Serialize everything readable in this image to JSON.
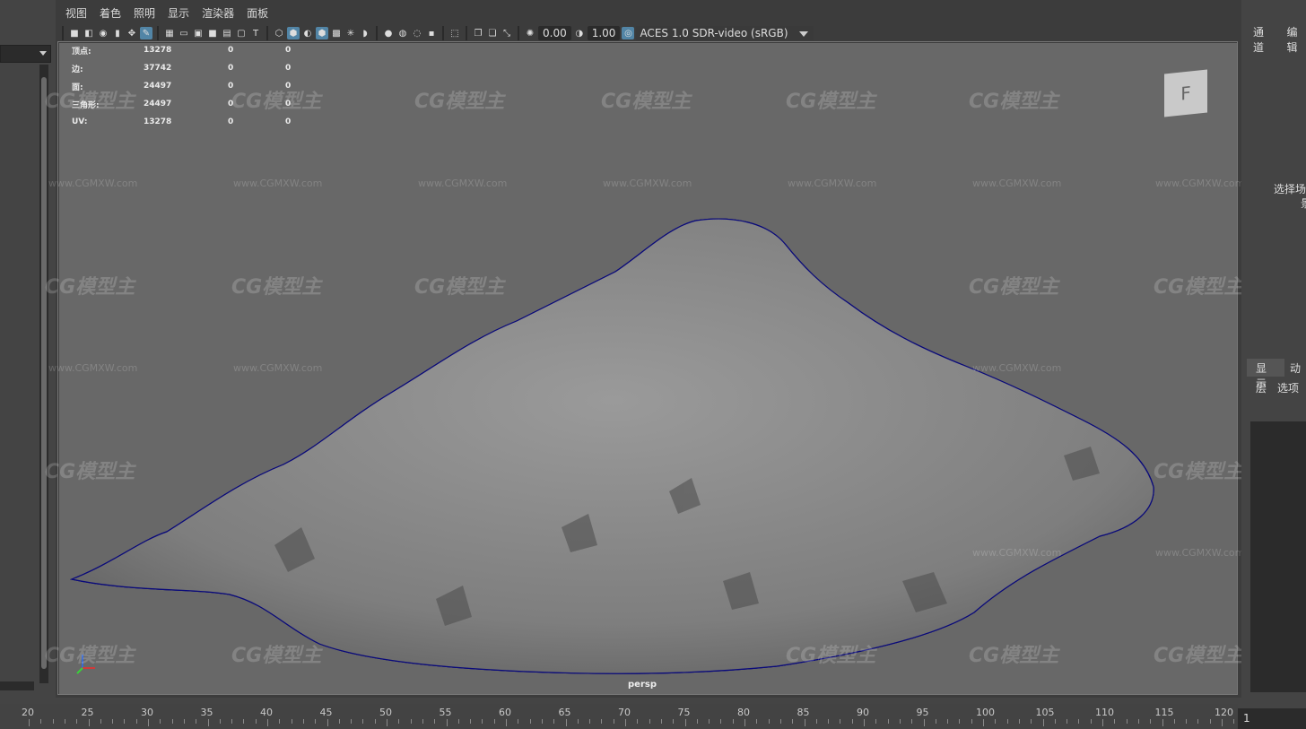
{
  "menu": [
    "视图",
    "着色",
    "照明",
    "显示",
    "渲染器",
    "面板"
  ],
  "toolbar": {
    "exposure": "0.00",
    "gamma": "1.00",
    "color_management": "ACES 1.0 SDR-video (sRGB)"
  },
  "hud": [
    {
      "label": "顶点:",
      "v1": "13278",
      "v2": "0",
      "v3": "0"
    },
    {
      "label": "边:",
      "v1": "37742",
      "v2": "0",
      "v3": "0"
    },
    {
      "label": "面:",
      "v1": "24497",
      "v2": "0",
      "v3": "0"
    },
    {
      "label": "三角形:",
      "v1": "24497",
      "v2": "0",
      "v3": "0"
    },
    {
      "label": "UV:",
      "v1": "13278",
      "v2": "0",
      "v3": "0"
    }
  ],
  "camera_label": "persp",
  "viewcube_face": "F",
  "right_panel": {
    "tabs": [
      "通道",
      "编辑"
    ],
    "hint_line1": "选择场",
    "hint_line2": "景",
    "layer_tabs": [
      "显示",
      "动"
    ],
    "layer_menu": [
      "层",
      "选项"
    ]
  },
  "timeline": {
    "labels": [
      "20",
      "25",
      "30",
      "35",
      "40",
      "45",
      "50",
      "55",
      "60",
      "65",
      "70",
      "75",
      "80",
      "85",
      "90",
      "95",
      "100",
      "105",
      "110",
      "115",
      "120"
    ],
    "current_frame": "1"
  },
  "watermark": {
    "logo": "CG模型主",
    "url": "www.CGMXW.com"
  },
  "colors": {
    "wire": "#0a0a7a",
    "viewport_bg": "#686868",
    "accent": "#5285a6"
  }
}
